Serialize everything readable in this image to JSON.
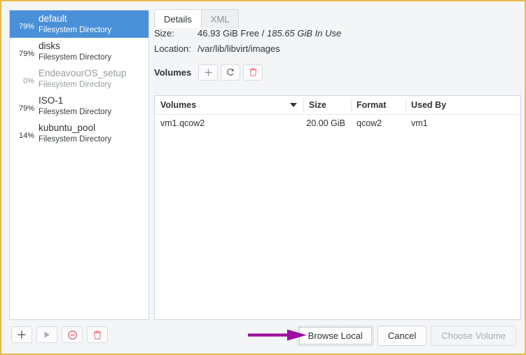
{
  "window": {
    "border_color": "#e9b949",
    "background": "#f4f5f6"
  },
  "pool_list": {
    "name": "storage-pool-list",
    "selected_index": 0,
    "items": [
      {
        "percent": "79%",
        "name": "default",
        "type": "Filesystem Directory",
        "selected": true,
        "dim": false
      },
      {
        "percent": "79%",
        "name": "disks",
        "type": "Filesystem Directory",
        "selected": false,
        "dim": false
      },
      {
        "percent": "0%",
        "name": "EndeavourOS_setup",
        "type": "Filesystem Directory",
        "selected": false,
        "dim": true
      },
      {
        "percent": "79%",
        "name": "ISO-1",
        "type": "Filesystem Directory",
        "selected": false,
        "dim": false
      },
      {
        "percent": "14%",
        "name": "kubuntu_pool",
        "type": "Filesystem Directory",
        "selected": false,
        "dim": false
      }
    ]
  },
  "pool_toolbar": {
    "add": {
      "icon": "plus-icon",
      "enabled": true
    },
    "start": {
      "icon": "play-icon",
      "enabled": false
    },
    "stop": {
      "icon": "stop-circle-icon",
      "enabled": true
    },
    "delete": {
      "icon": "trash-icon",
      "enabled": true
    }
  },
  "tabs": [
    {
      "label": "Details",
      "active": true
    },
    {
      "label": "XML",
      "active": false
    }
  ],
  "details": {
    "size_label": "Size:",
    "size_free": "46.93 GiB Free /",
    "size_in_use": "185.65 GiB In Use",
    "location_label": "Location:",
    "location_value": "/var/lib/libvirt/images",
    "volumes_label": "Volumes"
  },
  "volume_toolbar": {
    "add": {
      "icon": "plus-icon"
    },
    "refresh": {
      "icon": "refresh-icon"
    },
    "delete": {
      "icon": "trash-icon"
    }
  },
  "volumes_table": {
    "columns": [
      "Volumes",
      "Size",
      "Format",
      "Used By"
    ],
    "sort_column": 0,
    "sort_direction": "descending",
    "rows": [
      {
        "volume": "vm1.qcow2",
        "size": "20.00 GiB",
        "format": "qcow2",
        "used_by": "vm1"
      }
    ]
  },
  "dialog_buttons": [
    {
      "label": "Browse Local",
      "state": "focused"
    },
    {
      "label": "Cancel",
      "state": "normal"
    },
    {
      "label": "Choose Volume",
      "state": "disabled"
    }
  ],
  "annotation": {
    "arrow_color": "#9d0f9d",
    "points_to": "Browse Local"
  },
  "colors": {
    "selection": "#4a90d9",
    "accent_border": "#e9b949",
    "destructive": "#e8838a",
    "panel_bg": "#f4f5f6"
  }
}
